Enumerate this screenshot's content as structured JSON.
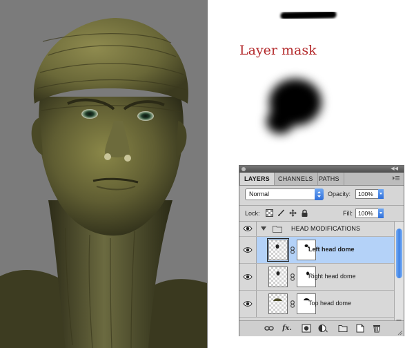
{
  "mask_label": "Layer mask",
  "panel": {
    "tabs": [
      {
        "label": "LAYERS",
        "active": true
      },
      {
        "label": "CHANNELS",
        "active": false
      },
      {
        "label": "PATHS",
        "active": false
      }
    ],
    "blend_mode": "Normal",
    "opacity_label": "Opacity:",
    "opacity_value": "100%",
    "lock_label": "Lock:",
    "fill_label": "Fill:",
    "fill_value": "100%",
    "group": {
      "name": "HEAD MODIFICATIONS",
      "expanded": true
    },
    "layers": [
      {
        "name": "Left head dome",
        "selected": true
      },
      {
        "name": "Right head dome",
        "selected": false
      },
      {
        "name": "Top head dome",
        "selected": false
      }
    ],
    "footer_icons": [
      "link-layers-icon",
      "fx-icon",
      "add-mask-icon",
      "adjustment-layer-icon",
      "new-group-icon",
      "new-layer-icon",
      "trash-icon"
    ],
    "footer_fx": "fx."
  },
  "colors": {
    "label_red": "#b3282a",
    "selection_blue": "#b4d2f8",
    "render_background": "#7b7b7b",
    "skin": "#5f5e32"
  }
}
